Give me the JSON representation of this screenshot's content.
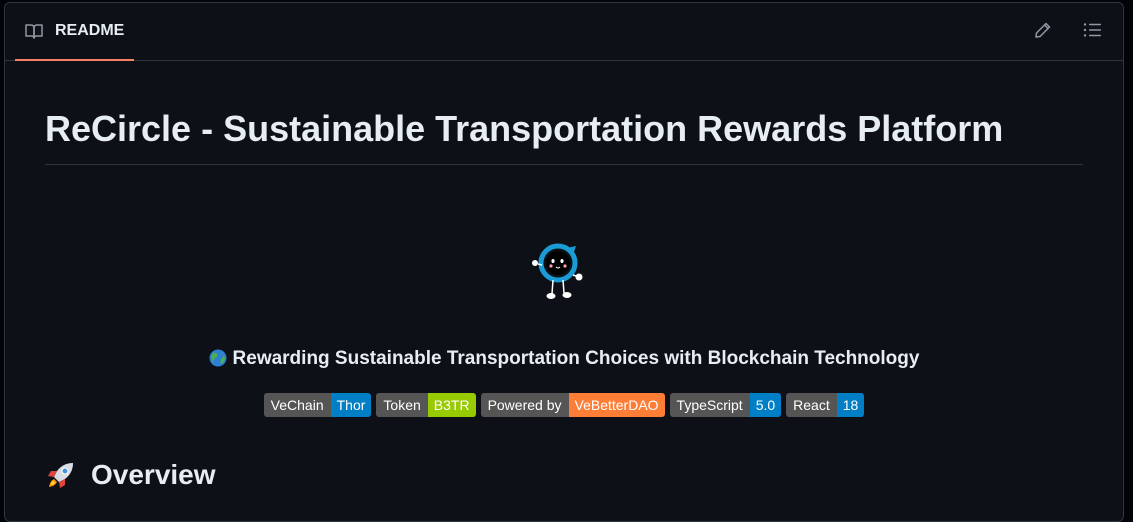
{
  "header": {
    "tab_label": "README",
    "tab_icon": "book-icon",
    "edit_icon": "pencil-icon",
    "toc_icon": "list-icon",
    "accent": "#f78166"
  },
  "readme": {
    "title": "ReCircle - Sustainable Transportation Rewards Platform",
    "logo_icon": "recircle-mascot-logo",
    "tagline_icon": "globe-icon",
    "tagline": "Rewarding Sustainable Transportation Choices with Blockchain Technology",
    "badges": [
      {
        "label": "VeChain",
        "value": "Thor",
        "color": "#007ec6"
      },
      {
        "label": "Token",
        "value": "B3TR",
        "color": "#97ca00"
      },
      {
        "label": "Powered by",
        "value": "VeBetterDAO",
        "color": "#fe7d37"
      },
      {
        "label": "TypeScript",
        "value": "5.0",
        "color": "#007ec6"
      },
      {
        "label": "React",
        "value": "18",
        "color": "#007ec6"
      }
    ],
    "section_icon": "rocket-icon",
    "section_heading": "Overview"
  }
}
